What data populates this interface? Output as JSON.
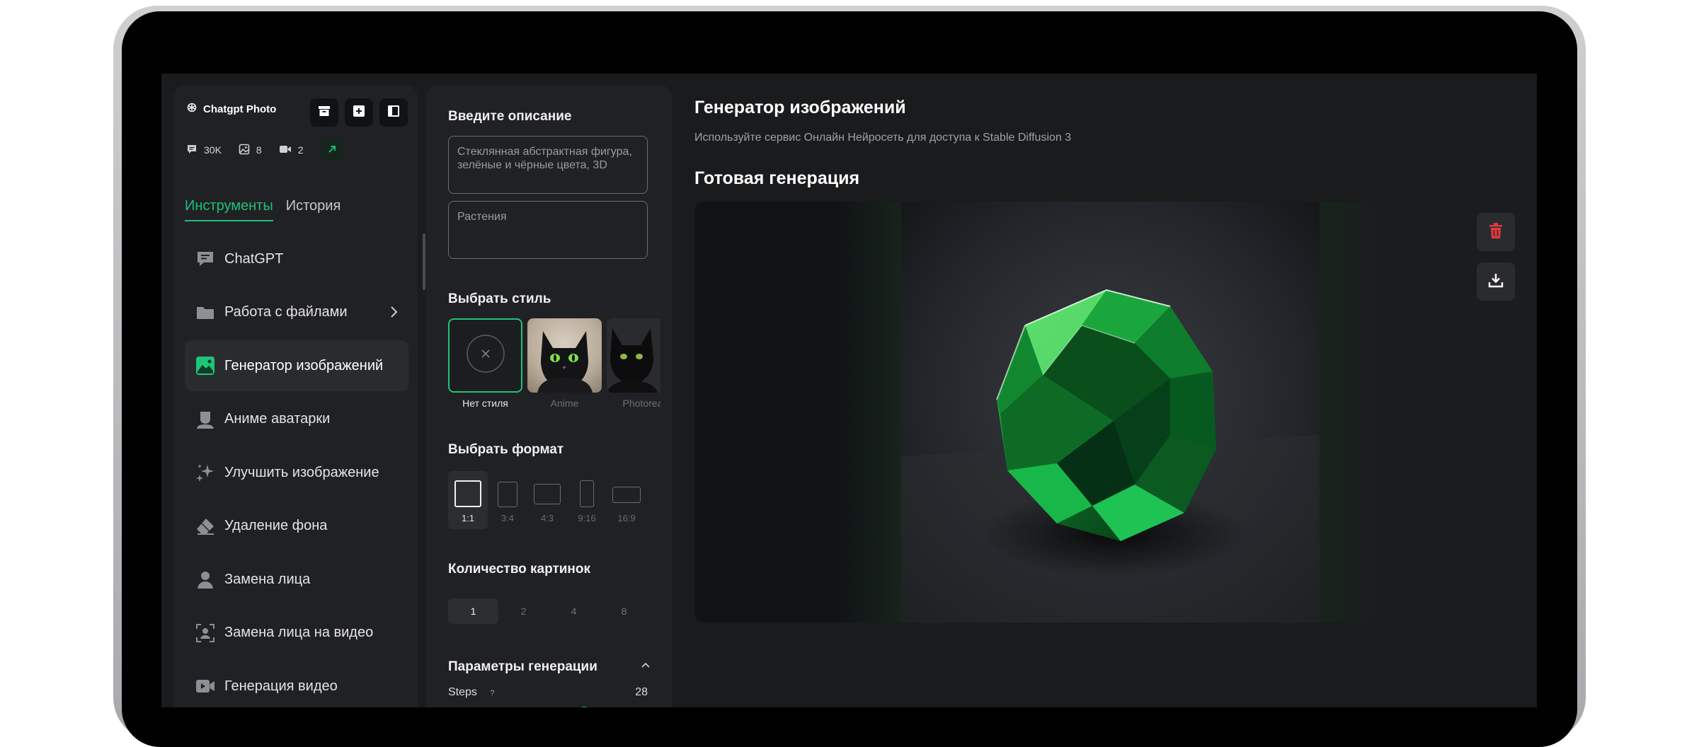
{
  "app": {
    "name": "Chatgpt Photo"
  },
  "stats": {
    "messages": "30K",
    "images": "8",
    "videos": "2"
  },
  "tabs": {
    "tools": "Инструменты",
    "history": "История"
  },
  "nav": [
    {
      "label": "ChatGPT",
      "icon": "chat-icon"
    },
    {
      "label": "Работа с файлами",
      "icon": "folder-icon"
    },
    {
      "label": "Генератор изображений",
      "icon": "image-icon",
      "active": true
    },
    {
      "label": "Аниме аватарки",
      "icon": "avatar-icon"
    },
    {
      "label": "Улучшить изображение",
      "icon": "sparkles-icon"
    },
    {
      "label": "Удаление фона",
      "icon": "eraser-icon"
    },
    {
      "label": "Замена лица",
      "icon": "user-icon"
    },
    {
      "label": "Замена лица на видео",
      "icon": "face-scan-icon"
    },
    {
      "label": "Генерация видео",
      "icon": "video-icon"
    }
  ],
  "panel": {
    "prompt_heading": "Введите описание",
    "prompt_value": "Стеклянная абстрактная фигура, зелёные и чёрные цвета, 3D",
    "negative_value": "Растения",
    "style_heading": "Выбрать стиль",
    "styles": [
      {
        "label": "Нет стиля",
        "active": true
      },
      {
        "label": "Anime"
      },
      {
        "label": "Photoreal"
      }
    ],
    "format_heading": "Выбрать формат",
    "formats": [
      {
        "label": "1:1",
        "active": true
      },
      {
        "label": "3:4"
      },
      {
        "label": "4:3"
      },
      {
        "label": "9:16"
      },
      {
        "label": "16:9"
      }
    ],
    "count_heading": "Количество картинок",
    "counts": [
      {
        "label": "1",
        "active": true
      },
      {
        "label": "2"
      },
      {
        "label": "4"
      },
      {
        "label": "8"
      }
    ],
    "params_heading": "Параметры генерации",
    "steps_label": "Steps",
    "steps_help": "?",
    "steps_value": "28",
    "steps_fraction": 0.68
  },
  "main": {
    "title": "Генератор изображений",
    "subtitle": "Используйте сервис Онлайн Нейросеть для доступа к Stable Diffusion 3",
    "result_heading": "Готовая генерация"
  },
  "colors": {
    "accent": "#1fc477",
    "danger": "#e5393d",
    "background": "#1a1b1d",
    "panel": "#202124"
  }
}
